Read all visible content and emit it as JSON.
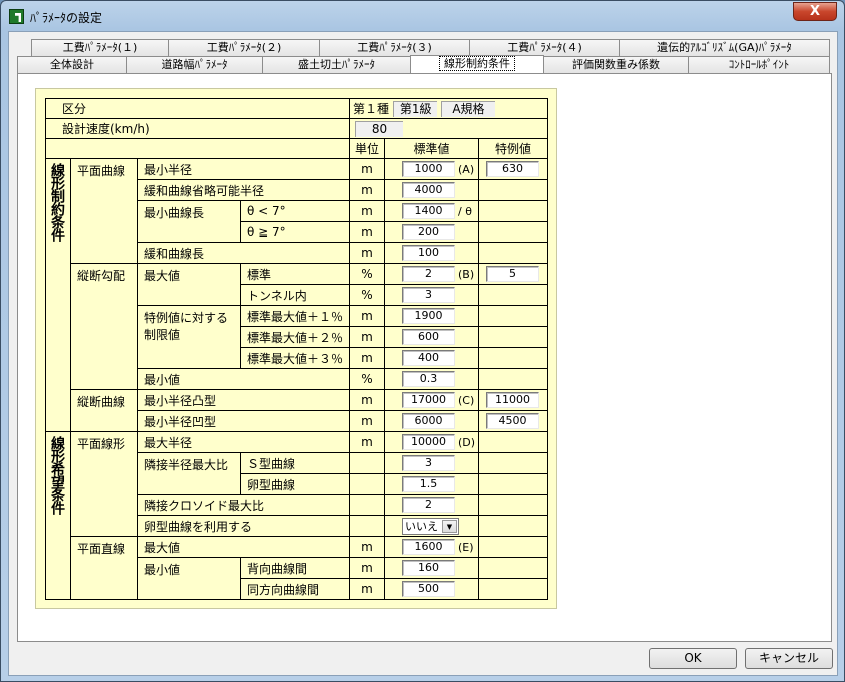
{
  "window": {
    "title": "ﾊﾟﾗﾒｰﾀの設定",
    "close_label": "X"
  },
  "tabs": {
    "row1": [
      "工費ﾊﾟﾗﾒｰﾀ(１)",
      "工費ﾊﾟﾗﾒｰﾀ(２)",
      "工費ﾊﾟﾗﾒｰﾀ(３)",
      "工費ﾊﾟﾗﾒｰﾀ(４)",
      "遺伝的ｱﾙｺﾞﾘｽﾞﾑ(GA)ﾊﾟﾗﾒｰﾀ"
    ],
    "row2": [
      "全体設計",
      "道路幅ﾊﾟﾗﾒｰﾀ",
      "盛土切土ﾊﾟﾗﾒｰﾀ",
      "線形制約条件",
      "評価関数重み係数",
      "ｺﾝﾄﾛｰﾙﾎﾟｲﾝﾄ"
    ],
    "selected": "線形制約条件"
  },
  "table": {
    "kubun_label": "区分",
    "kubun_type": "第１種",
    "kubun_class": "第1級",
    "kubun_spec": "A規格",
    "speed_label": "設計速度(km/h)",
    "speed_value": "80",
    "headers": {
      "unit": "単位",
      "standard": "標準値",
      "special": "特例値"
    },
    "groups": [
      "線形制約条件",
      "線形希望条件"
    ],
    "cats": [
      "平面曲線",
      "縦断勾配",
      "縦断曲線",
      "平面線形",
      "平面直線"
    ],
    "rows": [
      {
        "item": "最小半径",
        "unit": "m",
        "std": "1000",
        "mark": "(A)",
        "sp": "630"
      },
      {
        "item": "緩和曲線省略可能半径",
        "unit": "m",
        "std": "4000"
      },
      {
        "item": "最小曲線長",
        "sub": "θ < 7°",
        "unit": "m",
        "std": "1400",
        "mark": "/ θ"
      },
      {
        "sub": "θ ≧ 7°",
        "unit": "m",
        "std": "200"
      },
      {
        "item": "緩和曲線長",
        "unit": "m",
        "std": "100"
      },
      {
        "item": "最大値",
        "sub": "標準",
        "unit": "%",
        "std": "2",
        "mark": "(B)",
        "sp": "5"
      },
      {
        "sub": "トンネル内",
        "unit": "%",
        "std": "3"
      },
      {
        "item": "特例値に対する",
        "item2": "制限値",
        "sub": "標準最大値＋１％",
        "unit": "m",
        "std": "1900"
      },
      {
        "sub": "標準最大値＋２％",
        "unit": "m",
        "std": "600"
      },
      {
        "sub": "標準最大値＋３％",
        "unit": "m",
        "std": "400"
      },
      {
        "item": "最小値",
        "unit": "%",
        "std": "0.3"
      },
      {
        "item": "最小半径凸型",
        "unit": "m",
        "std": "17000",
        "mark": "(C)",
        "sp": "11000"
      },
      {
        "item": "最小半径凹型",
        "unit": "m",
        "std": "6000",
        "sp": "4500"
      },
      {
        "item": "最大半径",
        "unit": "m",
        "std": "10000",
        "mark": "(D)"
      },
      {
        "item": "隣接半径最大比",
        "sub": "Ｓ型曲線",
        "std": "3"
      },
      {
        "sub": "卵型曲線",
        "std": "1.5"
      },
      {
        "item": "隣接クロソイド最大比",
        "std": "2"
      },
      {
        "item": "卵型曲線を利用する",
        "select": "いいえ"
      },
      {
        "item": "最大値",
        "unit": "m",
        "std": "1600",
        "mark": "(E)"
      },
      {
        "item": "最小値",
        "sub": "背向曲線間",
        "unit": "m",
        "std": "160"
      },
      {
        "sub": "同方向曲線間",
        "unit": "m",
        "std": "500"
      }
    ]
  },
  "buttons": {
    "ok": "OK",
    "cancel": "キャンセル"
  }
}
